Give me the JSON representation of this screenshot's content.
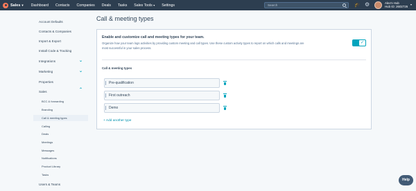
{
  "topnav": {
    "brand": "Sales",
    "links": [
      "Dashboard",
      "Contacts",
      "Companies",
      "Deals",
      "Tasks",
      "Sales Tools",
      "Settings"
    ],
    "search_placeholder": "Search",
    "account_name": "Alex's Hub",
    "hub_id": "Hub ID: 2602726"
  },
  "sidebar": {
    "account_defaults": "Account Defaults",
    "contacts_companies": "Contacts & Companies",
    "import_export": "Import & Export",
    "install_code": "Install Code & Tracking",
    "integrations": "Integrations",
    "marketing": "Marketing",
    "properties": "Properties",
    "sales": "Sales",
    "sales_items": [
      "BCC & forwarding",
      "Branding",
      "Call & meeting types",
      "Calling",
      "Deals",
      "Meetings",
      "Messages",
      "Notifications",
      "Product Library",
      "Tasks"
    ],
    "users_teams": "Users & Teams"
  },
  "main": {
    "title": "Call & meeting types",
    "card_heading": "Enable and customize call and meeting types for your team.",
    "card_description": "Organize how your team logs activities by providing custom meeting and call types. Use these custom activity types to report on which calls and meetings are most successful in your sales process.",
    "toggle_enabled": true,
    "section_label": "Call & meeting types",
    "types": [
      "Pre-qualification",
      "First outreach",
      "Demo"
    ],
    "add_link": "+ Add another type"
  },
  "help_label": "Help",
  "colors": {
    "nav_bg": "#2d3e50",
    "accent": "#00a4bd",
    "brand_orange": "#ff7a59",
    "link": "#0091ae"
  }
}
